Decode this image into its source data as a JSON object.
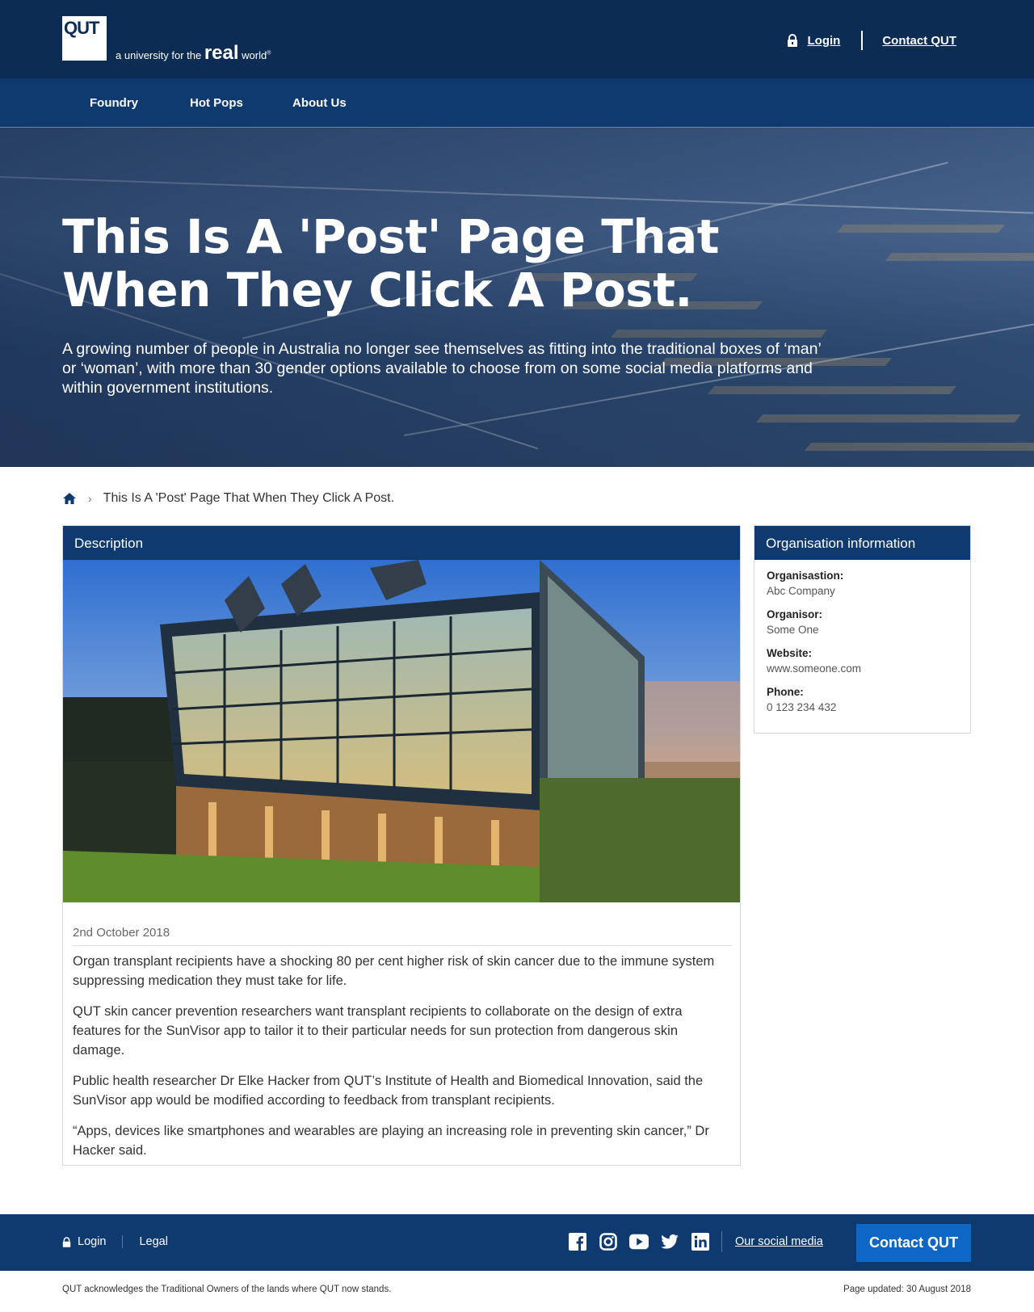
{
  "header": {
    "logo_text": "QUT",
    "tagline_prefix": "a university for the",
    "tagline_real": "real",
    "tagline_world": "world",
    "tagline_mark": "®",
    "login": "Login",
    "contact": "Contact QUT"
  },
  "nav": {
    "items": [
      {
        "label": "Foundry"
      },
      {
        "label": "Hot Pops"
      },
      {
        "label": "About Us"
      }
    ]
  },
  "hero": {
    "title": "This Is A 'Post' Page That When They Click A Post.",
    "intro": "A growing number of people in Australia no longer see themselves as fitting into the traditional boxes of ‘man’ or ‘woman’, with more than 30 gender options available to choose from on some social media platforms and within government institutions."
  },
  "breadcrumb": {
    "current": "This Is A 'Post' Page That When They Click A Post.",
    "separator": "›"
  },
  "description": {
    "heading": "Description",
    "date": "2nd October 2018",
    "paragraphs": [
      "Organ transplant recipients have a shocking 80 per cent higher risk of skin cancer due to the immune system suppressing medication they must take for life.",
      "QUT skin cancer prevention researchers want transplant recipients to collaborate on the design of extra features for the SunVisor app to tailor it to their particular needs for sun protection from dangerous skin damage.",
      "Public health researcher Dr Elke Hacker from QUT’s Institute of Health and Biomedical Innovation, said the SunVisor app would be modified according to feedback from transplant recipients.",
      "“Apps, devices like smartphones and wearables are playing an increasing role in preventing skin cancer,” Dr Hacker said."
    ]
  },
  "organisation": {
    "heading": "Organisation information",
    "fields": [
      {
        "label": "Organisastion:",
        "value": "Abc Company"
      },
      {
        "label": "Organisor:",
        "value": "Some One"
      },
      {
        "label": "Website:",
        "value": "www.someone.com"
      },
      {
        "label": "Phone:",
        "value": "0 123 234 432"
      }
    ]
  },
  "footer": {
    "login": "Login",
    "legal": "Legal",
    "social_icons": [
      "facebook-icon",
      "instagram-icon",
      "youtube-icon",
      "twitter-icon",
      "linkedin-icon"
    ],
    "our_social": "Our social media",
    "contact": "Contact QUT",
    "acknowledgement": "QUT acknowledges the Traditional Owners of the lands where QUT now stands.",
    "updated": "Page updated: 30 August 2018"
  },
  "colors": {
    "header_bg": "#0c2c53",
    "nav_bg": "#0f3a6f",
    "contact_button": "#0f67c5"
  }
}
